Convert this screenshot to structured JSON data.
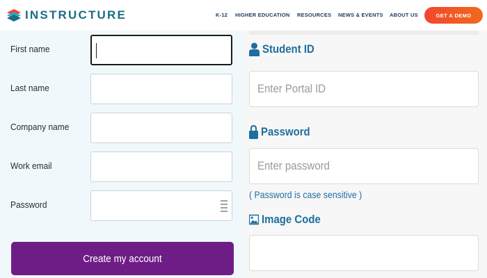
{
  "header": {
    "brand": "INSTRUCTURE",
    "nav": [
      "K-12",
      "HIGHER EDUCATION",
      "RESOURCES",
      "NEWS & EVENTS",
      "ABOUT US"
    ],
    "cta_label": "GET A DEMO"
  },
  "signup_form": {
    "first_name_label": "First name",
    "last_name_label": "Last name",
    "company_name_label": "Company name",
    "work_email_label": "Work email",
    "password_label": "Password",
    "submit_label": "Create my account"
  },
  "login_form": {
    "student_id_heading": "Student ID",
    "student_id_placeholder": "Enter Portal ID",
    "password_heading": "Password",
    "password_placeholder": "Enter password",
    "password_hint": "( Password is case sensitive )",
    "image_code_heading": "Image Code",
    "image_code_placeholder": ""
  },
  "colors": {
    "brand_teal": "#1a6e86",
    "nav_text": "#1c3a5c",
    "cta_orange": "#f2472f",
    "submit_purple": "#6f1d86",
    "heading_blue": "#1f6ea0"
  },
  "icons": {
    "brand_logo": "instructure-logo-icon",
    "student_id": "user-icon",
    "password": "lock-icon",
    "image_code": "image-icon",
    "password_toggle": "password-manager-icon"
  }
}
